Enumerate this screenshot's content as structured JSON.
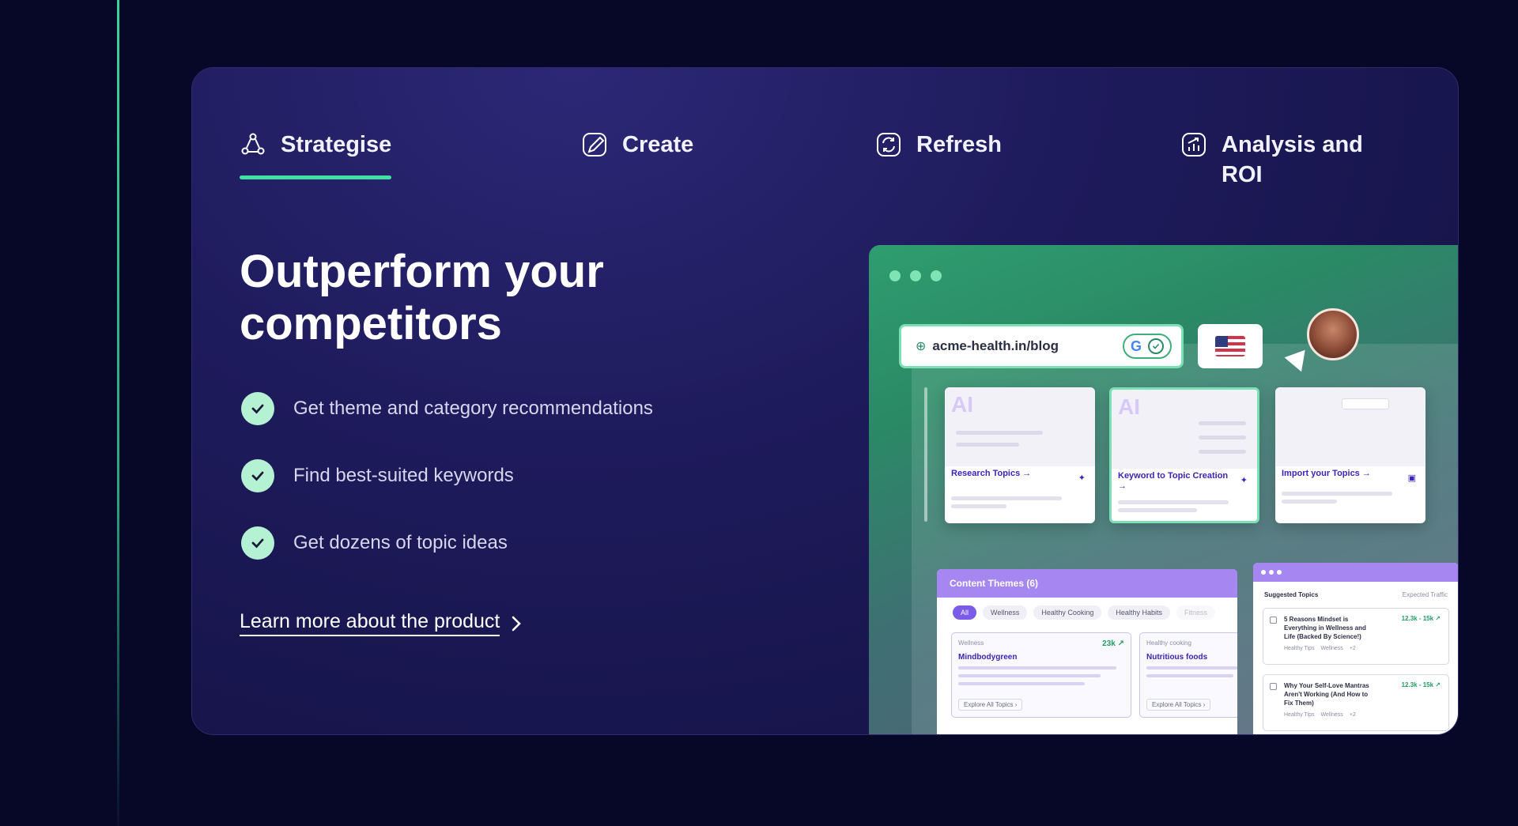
{
  "tabs": [
    {
      "label": "Strategise",
      "icon": "strategy-icon",
      "active": true
    },
    {
      "label": "Create",
      "icon": "brush-icon",
      "active": false
    },
    {
      "label": "Refresh",
      "icon": "refresh-icon",
      "active": false
    },
    {
      "label": "Analysis and ROI",
      "icon": "analytics-icon",
      "active": false
    }
  ],
  "headline": "Outperform your competitors",
  "features": [
    "Get theme and category recommendations",
    "Find best-suited keywords",
    "Get dozens of topic ideas"
  ],
  "learn_more": "Learn more about the product",
  "mock": {
    "url": "acme-health.in/blog",
    "search_engine": "G",
    "topic_cards": [
      {
        "ai": "AI",
        "title": "Research Topics →",
        "selected": false
      },
      {
        "ai": "AI",
        "title": "Keyword to Topic Creation →",
        "selected": true
      },
      {
        "ai": "",
        "title": "Import your Topics →",
        "selected": false
      }
    ],
    "themes": {
      "header": "Content Themes (6)",
      "chips": [
        "All",
        "Wellness",
        "Healthy Cooking",
        "Healthy Habits",
        "Fitness"
      ],
      "boxes": [
        {
          "category": "Wellness",
          "name": "Mindbodygreen",
          "value": "23k ↗",
          "explore": "Explore All Topics ›"
        },
        {
          "category": "Healthy cooking",
          "name": "Nutritious foods",
          "value": "",
          "explore": "Explore All Topics ›"
        }
      ]
    },
    "suggested": {
      "title": "Suggested Topics",
      "traffic_label": "Expected Traffic",
      "rows": [
        {
          "title": "5 Reasons Mindset is Everything in Wellness and Life (Backed By Science!)",
          "traffic": "12.3k - 15k ↗",
          "tags": [
            "Healthy Tips",
            "Wellness",
            "+2"
          ]
        },
        {
          "title": "Why Your Self-Love Mantras Aren't Working (And How to Fix Them)",
          "traffic": "12.3k - 15k ↗",
          "tags": [
            "Healthy Tips",
            "Wellness",
            "+2"
          ]
        }
      ]
    }
  },
  "colors": {
    "accent": "#3fe0a4",
    "card_bg": "#1e1b5c",
    "page_bg": "#070828",
    "purple": "#a687f2"
  }
}
